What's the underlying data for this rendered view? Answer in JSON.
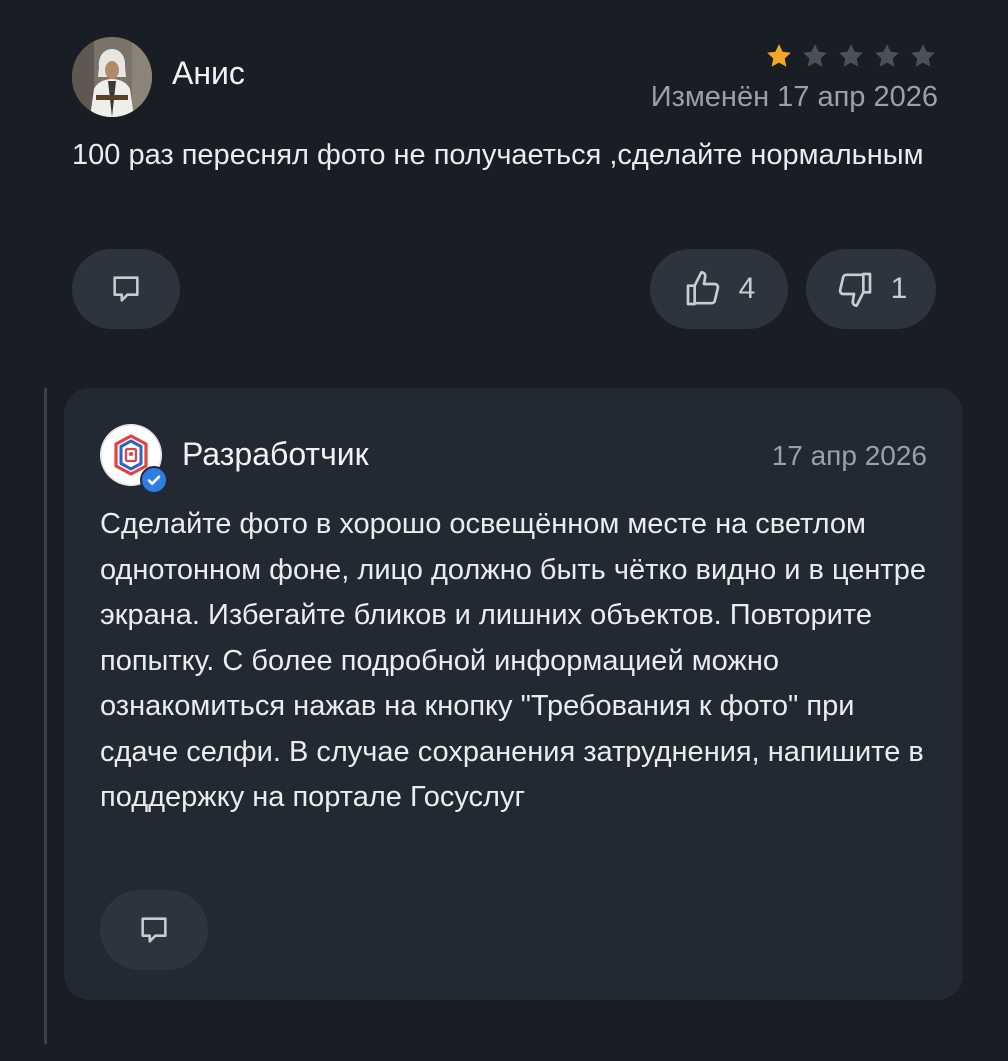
{
  "review": {
    "author": "Анис",
    "rating": 1,
    "rating_max": 5,
    "date": "Изменён 17 апр 2026",
    "text": "100 раз переснял фото не получаеться ,сделайте нормальным",
    "likes": "4",
    "dislikes": "1"
  },
  "reply": {
    "author": "Разработчик",
    "date": "17 апр 2026",
    "text": "Сделайте фото в хорошо освещённом месте на светлом однотонном фоне, лицо должно быть чётко видно и в центре экрана. Избегайте бликов и лишних объектов. Повторите попытку. С более подробной информацией можно ознакомиться нажав на кнопку \"Требования к фото\" при сдаче селфи. В случае сохранения затруднения, напишите в поддержку на портале Госуслуг"
  },
  "icons": {
    "reply": "comment-icon",
    "like": "thumb-up-icon",
    "dislike": "thumb-down-icon",
    "star": "star-icon",
    "verified": "verified-check-icon"
  },
  "colors": {
    "background": "#191d24",
    "card": "#232932",
    "pill": "#2e343d",
    "star_filled": "#f5a623",
    "star_empty": "#4a505a",
    "verified": "#2f7de1",
    "brand_red": "#e1443f",
    "brand_blue": "#2a62c9"
  }
}
